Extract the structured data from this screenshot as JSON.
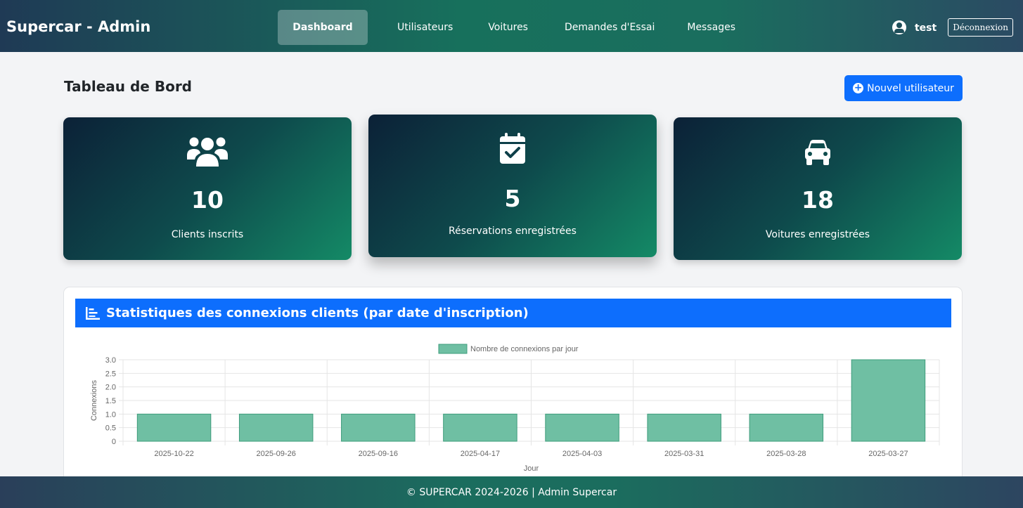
{
  "navbar": {
    "brand": "Supercar - Admin",
    "links": [
      {
        "label": "Dashboard"
      },
      {
        "label": "Utilisateurs"
      },
      {
        "label": "Voitures"
      },
      {
        "label": "Demandes d'Essai"
      },
      {
        "label": "Messages"
      }
    ],
    "active": "Dashboard",
    "user_name": "test",
    "logout_label": "Déconnexion"
  },
  "header": {
    "title": "Tableau de Bord",
    "new_user_label": "Nouvel utilisateur"
  },
  "stats": [
    {
      "icon": "users-icon",
      "value": "10",
      "label": "Clients inscrits"
    },
    {
      "icon": "calendar-check-icon",
      "value": "5",
      "label": "Réservations enregistrées"
    },
    {
      "icon": "car-icon",
      "value": "18",
      "label": "Voitures enregistrées"
    }
  ],
  "chart_section": {
    "title": "Statistiques des connexions clients (par date d'inscription)",
    "icon": "chart-bar-icon"
  },
  "chart_data": {
    "type": "bar",
    "categories": [
      "2025-10-22",
      "2025-09-26",
      "2025-09-16",
      "2025-04-17",
      "2025-04-03",
      "2025-03-31",
      "2025-03-28",
      "2025-03-27"
    ],
    "series": [
      {
        "name": "Nombre de connexions par jour",
        "values": [
          1,
          1,
          1,
          1,
          1,
          1,
          1,
          3
        ]
      }
    ],
    "xlabel": "Jour",
    "ylabel": "Connexions",
    "ylim": [
      0,
      3
    ],
    "yticks": [
      "0",
      "0.5",
      "1.0",
      "1.5",
      "2.0",
      "2.5",
      "3.0"
    ],
    "grid": true,
    "legend": "top-center",
    "colors": {
      "bar_fill": "#6fbfa3",
      "bar_stroke": "#3e9c7b"
    }
  },
  "footer": {
    "text": "© SUPERCAR 2024-2026 | Admin Supercar"
  }
}
